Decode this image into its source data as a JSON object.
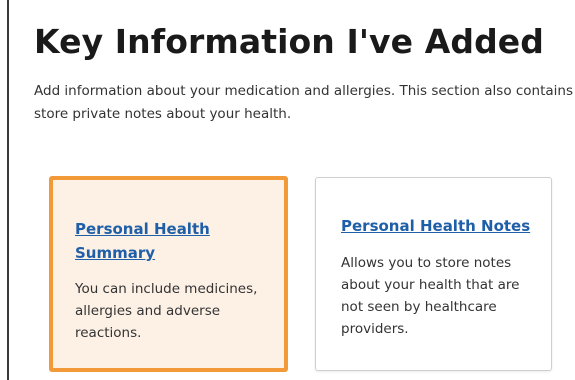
{
  "page": {
    "title": "Key Information I've Added",
    "description": "Add information about your medication and allergies. This section also contains store private notes about your health."
  },
  "cards": [
    {
      "link_label": "Personal Health Summary",
      "text": "You can include medicines, allergies and adverse reactions.",
      "selected": true
    },
    {
      "link_label": "Personal Health Notes",
      "text": "Allows you to store notes about your health that are not seen by healthcare providers.",
      "selected": false
    }
  ],
  "colors": {
    "highlight_border": "#f29a38",
    "highlight_fill": "#fdf1e6",
    "link": "#1f5fa8"
  }
}
